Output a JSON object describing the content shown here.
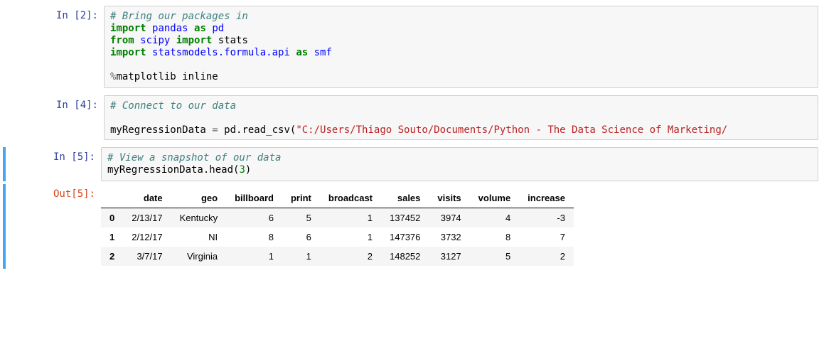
{
  "cells": {
    "c1": {
      "prompt": "In [2]:",
      "comment": "# Bring our packages in",
      "kw_import1": "import",
      "mod_pandas": "pandas",
      "kw_as1": "as",
      "alias_pd": "pd",
      "kw_from": "from",
      "mod_scipy": "scipy",
      "kw_import2": "import",
      "mod_stats": "stats",
      "kw_import3": "import",
      "mod_sm": "statsmodels.formula.api",
      "kw_as2": "as",
      "alias_smf": "smf",
      "magic_pct": "%",
      "magic": "matplotlib",
      "magic_arg": " inline"
    },
    "c2": {
      "prompt": "In [4]:",
      "comment": "# Connect to our data",
      "varname": "myRegressionData ",
      "eq": "=",
      "call": " pd.read_csv(",
      "path": "\"C:/Users/Thiago Souto/Documents/Python - The Data Science of Marketing/"
    },
    "c3": {
      "prompt_in": "In [5]:",
      "prompt_out": "Out[5]:",
      "comment": "# View a snapshot of our data",
      "call_a": "myRegressionData.head(",
      "num": "3",
      "call_b": ")"
    }
  },
  "table": {
    "columns": [
      "date",
      "geo",
      "billboard",
      "print",
      "broadcast",
      "sales",
      "visits",
      "volume",
      "increase"
    ],
    "rows": [
      {
        "idx": "0",
        "date": "2/13/17",
        "geo": "Kentucky",
        "billboard": "6",
        "print": "5",
        "broadcast": "1",
        "sales": "137452",
        "visits": "3974",
        "volume": "4",
        "increase": "-3"
      },
      {
        "idx": "1",
        "date": "2/12/17",
        "geo": "NI",
        "billboard": "8",
        "print": "6",
        "broadcast": "1",
        "sales": "147376",
        "visits": "3732",
        "volume": "8",
        "increase": "7"
      },
      {
        "idx": "2",
        "date": "3/7/17",
        "geo": "Virginia",
        "billboard": "1",
        "print": "1",
        "broadcast": "2",
        "sales": "148252",
        "visits": "3127",
        "volume": "5",
        "increase": "2"
      }
    ]
  }
}
